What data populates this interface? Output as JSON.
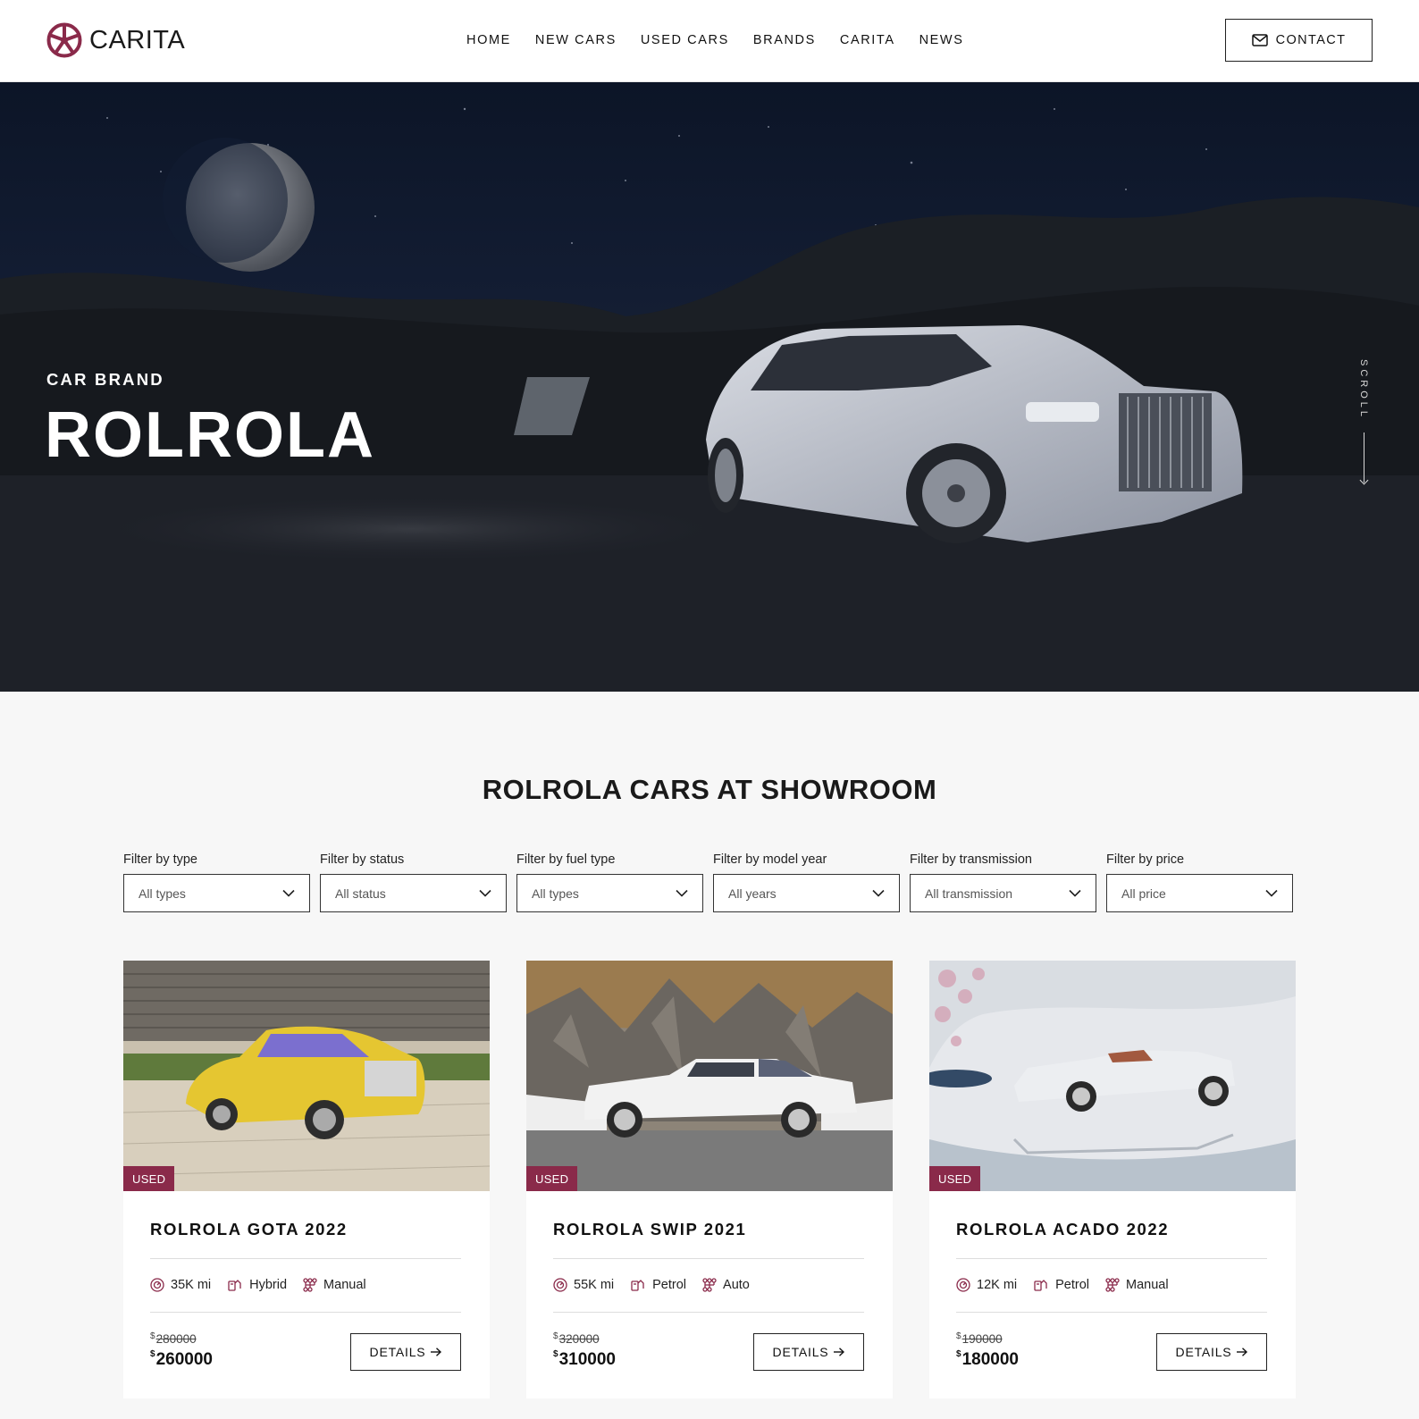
{
  "brand": {
    "name": "CARITA",
    "accent": "#8a2a4a"
  },
  "nav": {
    "items": [
      "HOME",
      "NEW CARS",
      "USED CARS",
      "BRANDS",
      "CARITA",
      "NEWS"
    ]
  },
  "contact": {
    "label": "CONTACT"
  },
  "hero": {
    "eyebrow": "CAR BRAND",
    "title": "ROLROLA",
    "scroll_label": "SCROLL"
  },
  "showroom": {
    "title": "ROLROLA CARS AT SHOWROOM"
  },
  "filters": [
    {
      "label": "Filter by type",
      "value": "All types"
    },
    {
      "label": "Filter by status",
      "value": "All status"
    },
    {
      "label": "Filter by fuel type",
      "value": "All types"
    },
    {
      "label": "Filter by model year",
      "value": "All years"
    },
    {
      "label": "Filter by transmission",
      "value": "All transmission"
    },
    {
      "label": "Filter by price",
      "value": "All price"
    }
  ],
  "cars": [
    {
      "badge": "USED",
      "title": "ROLROLA GOTA 2022",
      "mileage": "35K mi",
      "fuel": "Hybrid",
      "transmission": "Manual",
      "currency": "$",
      "old_price": "280000",
      "price": "260000",
      "details_label": "DETAILS"
    },
    {
      "badge": "USED",
      "title": "ROLROLA SWIP 2021",
      "mileage": "55K mi",
      "fuel": "Petrol",
      "transmission": "Auto",
      "currency": "$",
      "old_price": "320000",
      "price": "310000",
      "details_label": "DETAILS"
    },
    {
      "badge": "USED",
      "title": "ROLROLA ACADO 2022",
      "mileage": "12K mi",
      "fuel": "Petrol",
      "transmission": "Manual",
      "currency": "$",
      "old_price": "190000",
      "price": "180000",
      "details_label": "DETAILS"
    }
  ]
}
